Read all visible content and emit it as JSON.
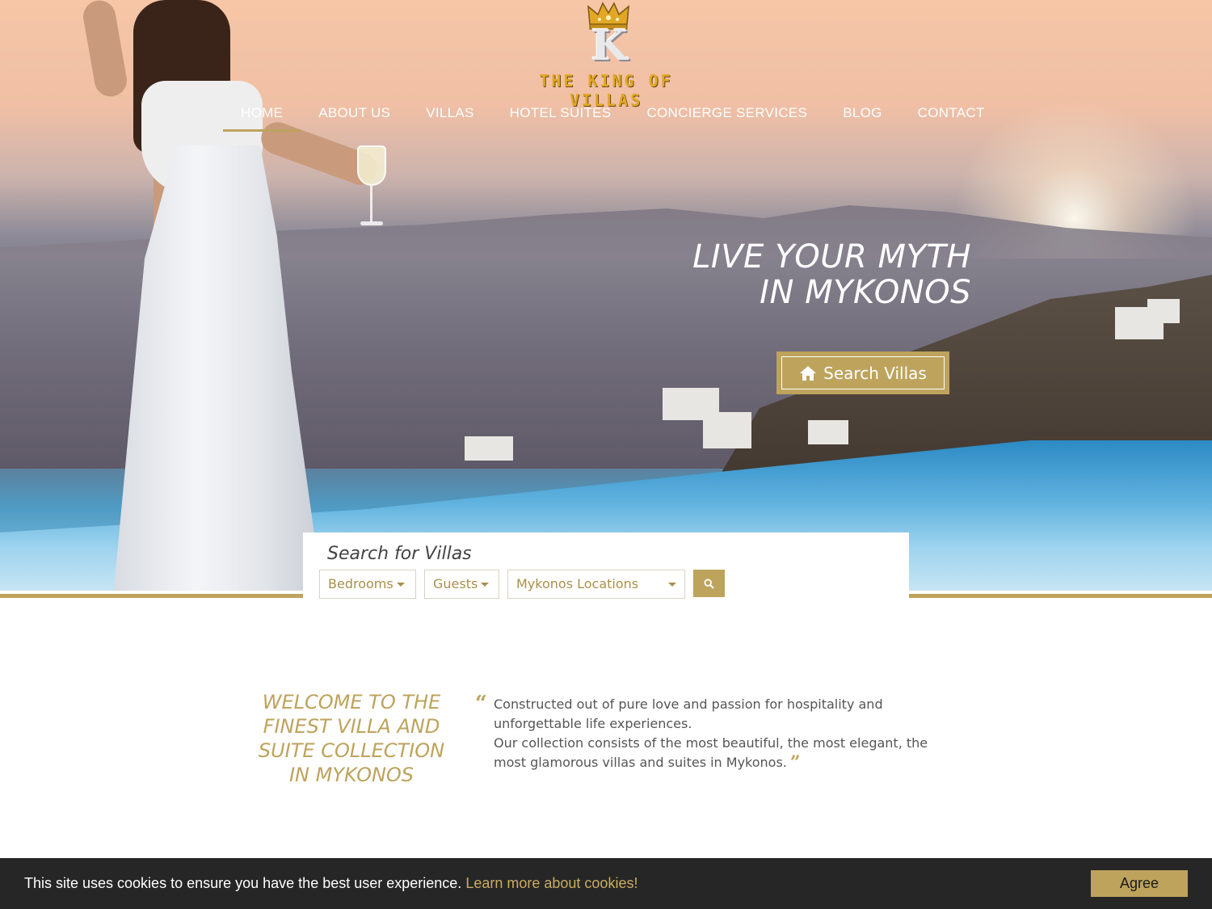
{
  "logo": {
    "monogram": "K",
    "brand_text": "THE KING OF VILLAS"
  },
  "nav": {
    "items": [
      {
        "label": "HOME",
        "active": true
      },
      {
        "label": "ABOUT US"
      },
      {
        "label": "VILLAS"
      },
      {
        "label": "HOTEL SUITES"
      },
      {
        "label": "CONCIERGE SERVICES"
      },
      {
        "label": "BLOG"
      },
      {
        "label": "CONTACT"
      }
    ]
  },
  "hero": {
    "tagline_line1": "LIVE YOUR MYTH",
    "tagline_line2": "IN MYKONOS",
    "cta_label": "Search Villas",
    "cta_icon": "home-icon"
  },
  "search": {
    "title": "Search for Villas",
    "bedrooms_label": "Bedrooms",
    "guests_label": "Guests",
    "location_label": "Mykonos Locations",
    "submit_icon": "search-icon"
  },
  "welcome": {
    "heading_line1": "WELCOME TO THE",
    "heading_line2": "FINEST VILLA AND",
    "heading_line3": "SUITE COLLECTION",
    "heading_line4": "IN MYKONOS",
    "text_line1": "Constructed out of pure love and passion for hospitality and",
    "text_line2": "unforgettable life experiences.",
    "text_line3": "Our collection consists of the most beautiful, the most elegant, the",
    "text_line4": "most glamorous villas and suites in Mykonos."
  },
  "cookie": {
    "message": "This site uses cookies to ensure you have the best user experience.",
    "link_label": "Learn more about cookies!",
    "agree_label": "Agree"
  },
  "colors": {
    "accent_gold": "#bda35c",
    "logo_gold": "#e2a825",
    "cookie_bg": "#262626"
  }
}
